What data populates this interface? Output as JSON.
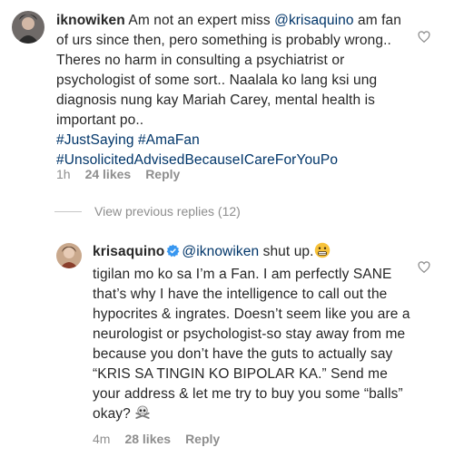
{
  "comment1": {
    "username": "iknowiken",
    "text_a": " Am not an expert miss ",
    "mention": "@krisaquino",
    "text_b": " am fan of urs since then, pero something is probably wrong.. Theres no harm in consulting a psychiatrist or psychologist of some sort.. Naalala ko lang ksi ung diagnosis nung kay Mariah Carey, mental health is important po..",
    "hashtags_line1": "#JustSaying #AmaFan",
    "hashtags_line2": "#UnsolicitedAdvisedBecauseICareForYouPo",
    "time": "1h",
    "likes": "24 likes",
    "reply": "Reply"
  },
  "view_replies": "View previous replies (12)",
  "comment2": {
    "username": "krisaquino",
    "mention": "@iknowiken",
    "text_a": " shut up.",
    "text_b": "tigilan mo ko sa I’m a Fan. I am perfectly SANE that’s why I have the intelligence to call out the hypocrites & ingrates. Doesn’t seem like you are a neurologist or psychologist-so stay away from me because you don’t have the guts to actually say “KRIS SA TINGIN KO BIPOLAR KA.” Send me your address & let me try to buy you some “balls” okay?",
    "time": "4m",
    "likes": "28 likes",
    "reply": "Reply"
  },
  "icons": {
    "heart": "heart-icon",
    "verified": "verified-badge-icon",
    "emoji1": "grimace-emoji-icon",
    "emoji2": "skull-crossbones-emoji-icon"
  },
  "colors": {
    "mention": "#003569",
    "muted": "#8e8e8e",
    "verified": "#3897f0"
  }
}
